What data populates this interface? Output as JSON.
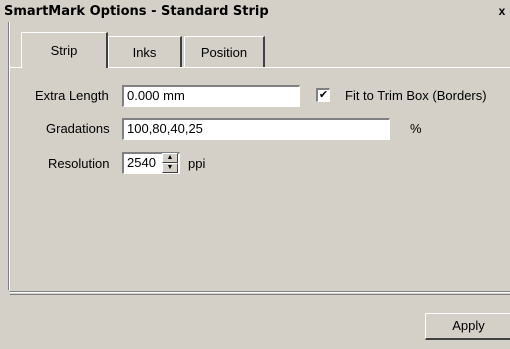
{
  "window": {
    "title": "SmartMark Options - Standard Strip",
    "close_label": "x"
  },
  "tabs": [
    {
      "label": "Strip",
      "active": true
    },
    {
      "label": "Inks",
      "active": false
    },
    {
      "label": "Position",
      "active": false
    }
  ],
  "strip": {
    "extra_length_label": "Extra Length",
    "extra_length_value": "0.000 mm",
    "fit_to_trim_label": "Fit to Trim Box (Borders)",
    "fit_to_trim_checked": true,
    "fit_to_trim_mark": "✔",
    "gradations_label": "Gradations",
    "gradations_value": "100,80,40,25",
    "gradations_unit": "%",
    "resolution_label": "Resolution",
    "resolution_value": "2540",
    "resolution_unit": "ppi"
  },
  "footer": {
    "apply_label": "Apply"
  }
}
